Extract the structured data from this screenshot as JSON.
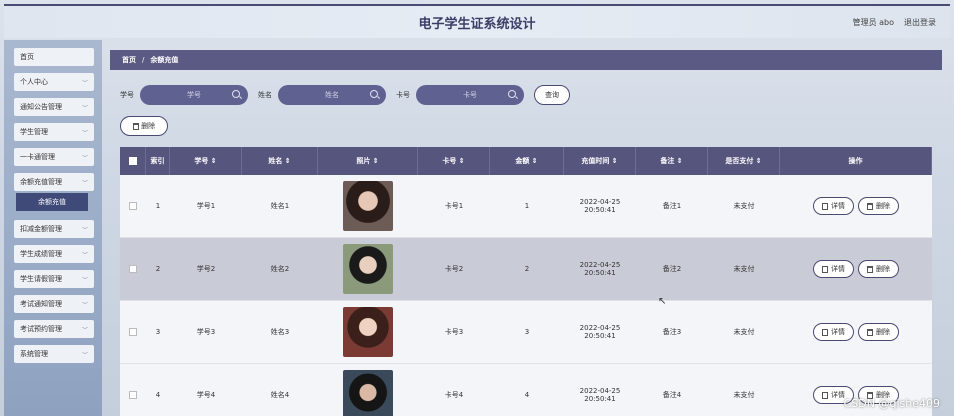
{
  "header": {
    "title": "电子学生证系统设计",
    "admin": "管理员 abo",
    "logout": "退出登录"
  },
  "sidebar": {
    "items": [
      {
        "label": "首页",
        "chev": false
      },
      {
        "label": "个人中心",
        "chev": true
      },
      {
        "label": "通知公告管理",
        "chev": true
      },
      {
        "label": "学生管理",
        "chev": true
      },
      {
        "label": "一卡通管理",
        "chev": true
      },
      {
        "label": "余额充值管理",
        "chev": true
      },
      {
        "label": "扣减金额管理",
        "chev": true
      },
      {
        "label": "学生成绩管理",
        "chev": true
      },
      {
        "label": "学生请假管理",
        "chev": true
      },
      {
        "label": "考试通知管理",
        "chev": true
      },
      {
        "label": "考试预约管理",
        "chev": true
      },
      {
        "label": "系统管理",
        "chev": true
      }
    ],
    "active_sub": "余额充值"
  },
  "breadcrumb": {
    "home": "首页",
    "sep": "/",
    "current": "余额充值"
  },
  "filters": {
    "student_no_label": "学号",
    "student_no_placeholder": "学号",
    "name_label": "姓名",
    "name_placeholder": "姓名",
    "card_label": "卡号",
    "card_placeholder": "卡号",
    "query_button": "查询"
  },
  "toolbar": {
    "delete_button": "删除"
  },
  "table": {
    "headers": {
      "index": "索引",
      "student_no": "学号 ⇕",
      "name": "姓名 ⇕",
      "photo": "照片 ⇕",
      "card_no": "卡号 ⇕",
      "amount": "金额 ⇕",
      "recharge_time": "充值时间 ⇕",
      "note": "备注 ⇕",
      "paid": "是否支付 ⇕",
      "actions": "操作"
    },
    "rows": [
      {
        "index": "1",
        "student_no": "学号1",
        "name": "姓名1",
        "card_no": "卡号1",
        "amount": "1",
        "recharge_time": "2022-04-25 20:50:41",
        "note": "备注1",
        "paid": "未支付"
      },
      {
        "index": "2",
        "student_no": "学号2",
        "name": "姓名2",
        "card_no": "卡号2",
        "amount": "2",
        "recharge_time": "2022-04-25 20:50:41",
        "note": "备注2",
        "paid": "未支付"
      },
      {
        "index": "3",
        "student_no": "学号3",
        "name": "姓名3",
        "card_no": "卡号3",
        "amount": "3",
        "recharge_time": "2022-04-25 20:50:41",
        "note": "备注3",
        "paid": "未支付"
      },
      {
        "index": "4",
        "student_no": "学号4",
        "name": "姓名4",
        "card_no": "卡号4",
        "amount": "4",
        "recharge_time": "2022-04-25 20:50:41",
        "note": "备注4",
        "paid": "未支付"
      }
    ],
    "detail_button": "详情",
    "delete_button": "删除"
  },
  "watermark": "CSDN @qishe409",
  "colors": {
    "accent": "#55557e",
    "sidebar_active": "#3f4a78"
  }
}
